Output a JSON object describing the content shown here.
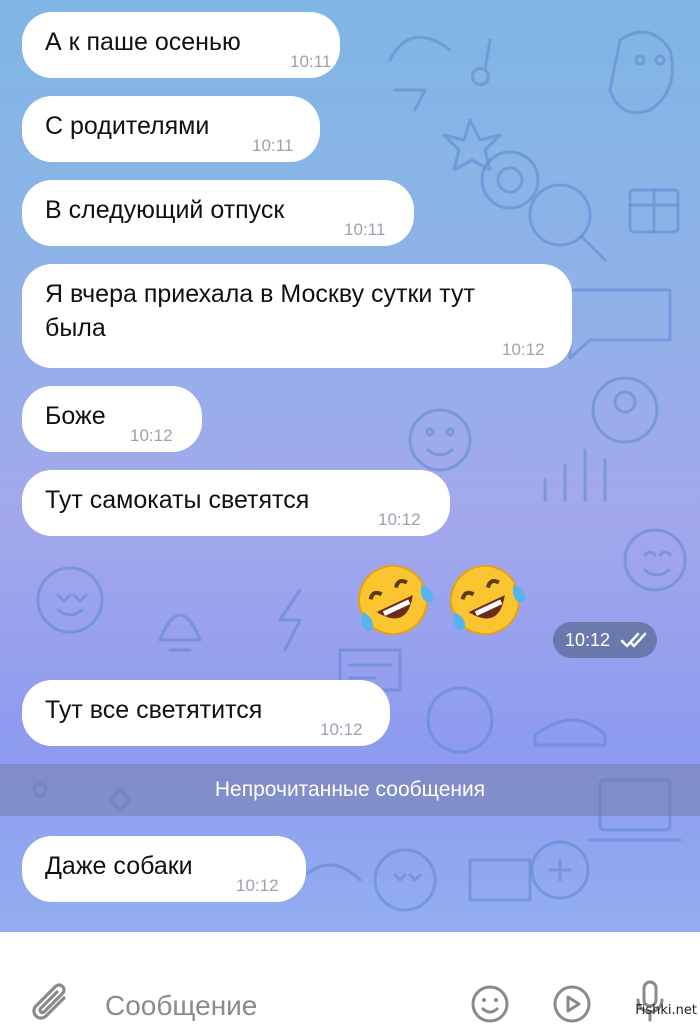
{
  "messages": [
    {
      "text": "А к паше осенью",
      "time": "10:11"
    },
    {
      "text": "С родителями",
      "time": "10:11"
    },
    {
      "text": "В следующий отпуск",
      "time": "10:11"
    },
    {
      "text": "Я вчера приехала в Москву сутки тут\nбыла",
      "time": "10:12"
    },
    {
      "text": "Боже",
      "time": "10:12"
    },
    {
      "text": "Тут самокаты светятся",
      "time": "10:12"
    },
    {
      "text": "Тут все светятится",
      "time": "10:12"
    },
    {
      "text": "Даже собаки",
      "time": "10:12"
    }
  ],
  "outgoing": {
    "emoji": "🤣🤣",
    "time": "10:12",
    "status_icon": "double-check-icon"
  },
  "unread_divider": "Непрочитанные сообщения",
  "input": {
    "placeholder": "Сообщение"
  },
  "icons": [
    "paperclip-icon",
    "smile-icon",
    "play-icon",
    "microphone-icon"
  ],
  "watermark": "Fishki.net",
  "colors": {
    "bubble": "#ffffff",
    "time": "#9aa3ad",
    "accent_bg": "#8fb2e8"
  }
}
